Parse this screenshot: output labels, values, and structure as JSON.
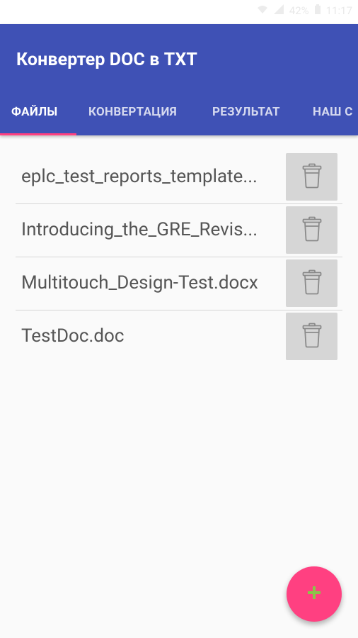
{
  "status_bar": {
    "battery": "42%",
    "time": "11:17"
  },
  "app_bar": {
    "title": "Конвертер DOC в TXT"
  },
  "tabs": [
    {
      "label": "ФАЙЛЫ",
      "active": true
    },
    {
      "label": "КОНВЕРТАЦИЯ",
      "active": false
    },
    {
      "label": "РЕЗУЛЬТАТ",
      "active": false
    },
    {
      "label": "НАШ С",
      "active": false
    }
  ],
  "files": [
    {
      "name": "eplc_test_reports_template..."
    },
    {
      "name": "Introducing_the_GRE_Revis..."
    },
    {
      "name": "Multitouch_Design-Test.docx"
    },
    {
      "name": "TestDoc.doc"
    }
  ],
  "icons": {
    "delete": "trash-icon",
    "add": "plus-icon"
  },
  "colors": {
    "primary": "#3f51b5",
    "accent": "#ff4081",
    "fab_icon": "#8bc34a"
  }
}
